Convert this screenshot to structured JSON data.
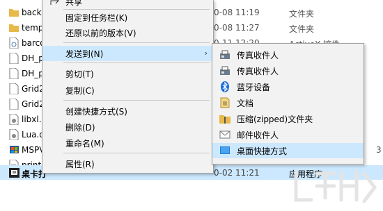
{
  "files": [
    {
      "name": "backu",
      "date": "0-08 11:19",
      "type": "文件夹",
      "size": "",
      "icon": "folder-icon"
    },
    {
      "name": "temp",
      "date": "0-08 11:27",
      "type": "文件夹",
      "size": "",
      "icon": "folder-icon"
    },
    {
      "name": "barco",
      "date": "0-11 12:20",
      "type": "ActiveX 控件",
      "size": "",
      "icon": "ocx-file-icon"
    },
    {
      "name": "DH_p",
      "date": "",
      "type": "",
      "size": "",
      "icon": "file-icon"
    },
    {
      "name": "DH_p",
      "date": "",
      "type": "",
      "size": "",
      "icon": "file-icon"
    },
    {
      "name": "Grid2",
      "date": "",
      "type": "",
      "size": "",
      "icon": "file-icon"
    },
    {
      "name": "Grid2",
      "date": "",
      "type": "",
      "size": "",
      "icon": "file-icon"
    },
    {
      "name": "libxl.",
      "date": "",
      "type": "",
      "size": "",
      "icon": "gear-file-icon"
    },
    {
      "name": "Lua.d",
      "date": "",
      "type": "",
      "size": "",
      "icon": "gear-file-icon"
    },
    {
      "name": "MSPV",
      "date": "",
      "type": "",
      "size": "3",
      "icon": "app-icon"
    },
    {
      "name": "print.",
      "date": "",
      "type": "",
      "size": "",
      "icon": "text-file-icon"
    },
    {
      "name": "桌卡打",
      "date": "0-02 11:21",
      "type": "应用程序",
      "size": "",
      "icon": "app-icon"
    }
  ],
  "context_menu": {
    "items": [
      {
        "label": "共享",
        "icon": "share-icon"
      },
      {
        "label": "固定到任务栏(K)"
      },
      {
        "label": "还原以前的版本(V)"
      },
      {
        "label": "发送到(N)",
        "has_submenu": true
      },
      {
        "label": "剪切(T)"
      },
      {
        "label": "复制(C)"
      },
      {
        "label": "创建快捷方式(S)"
      },
      {
        "label": "删除(D)"
      },
      {
        "label": "重命名(M)"
      },
      {
        "label": "属性(R)"
      }
    ]
  },
  "send_to_menu": {
    "items": [
      {
        "label": "传真收件人",
        "icon": "fax-icon"
      },
      {
        "label": "传真收件人",
        "icon": "fax-icon"
      },
      {
        "label": "蓝牙设备",
        "icon": "bluetooth-icon"
      },
      {
        "label": "文档",
        "icon": "documents-icon"
      },
      {
        "label": "压缩(zipped)文件夹",
        "icon": "zip-folder-icon"
      },
      {
        "label": "邮件收件人",
        "icon": "mail-icon"
      },
      {
        "label": "桌面快捷方式",
        "icon": "desktop-icon"
      }
    ]
  },
  "colors": {
    "selection": "#cce8ff",
    "menu_bg": "#f2f2f2",
    "folder": "#e8b84a"
  }
}
